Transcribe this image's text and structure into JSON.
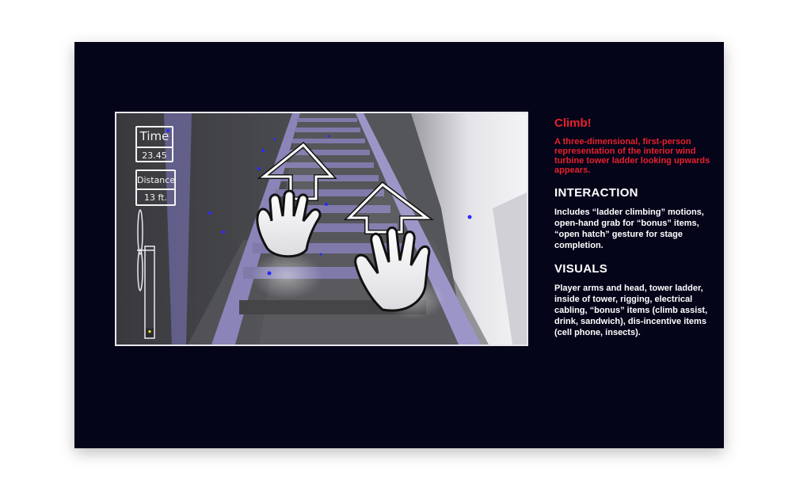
{
  "hud": {
    "time_label": "Time",
    "time_value": "23.45",
    "distance_label": "Distance",
    "distance_value": "13 ft."
  },
  "progress": {
    "fraction": 0.1
  },
  "description": {
    "title": "Climb!",
    "intro": "A three-dimensional, first-person representation of the interior wind turbine tower ladder looking upwards appears.",
    "interaction_heading": "INTERACTION",
    "interaction_text": "Includes “ladder climbing” motions, open-hand grab for “bonus” items, “open hatch” gesture for stage completion.",
    "visuals_heading": "VISUALS",
    "visuals_text": "Player arms and head, tower ladder, inside of tower, rigging, electrical cabling, “bonus” items (climb assist, drink, sandwich), dis-incentive items (cell phone, insects)."
  },
  "colors": {
    "slide_background": "#05051a",
    "accent_red": "#e8202a",
    "ladder_purple": "#8a84b8",
    "particle_blue": "#2a2aff"
  },
  "icons": [
    "up-arrow-icon",
    "open-hand-icon",
    "wind-turbine-icon"
  ]
}
